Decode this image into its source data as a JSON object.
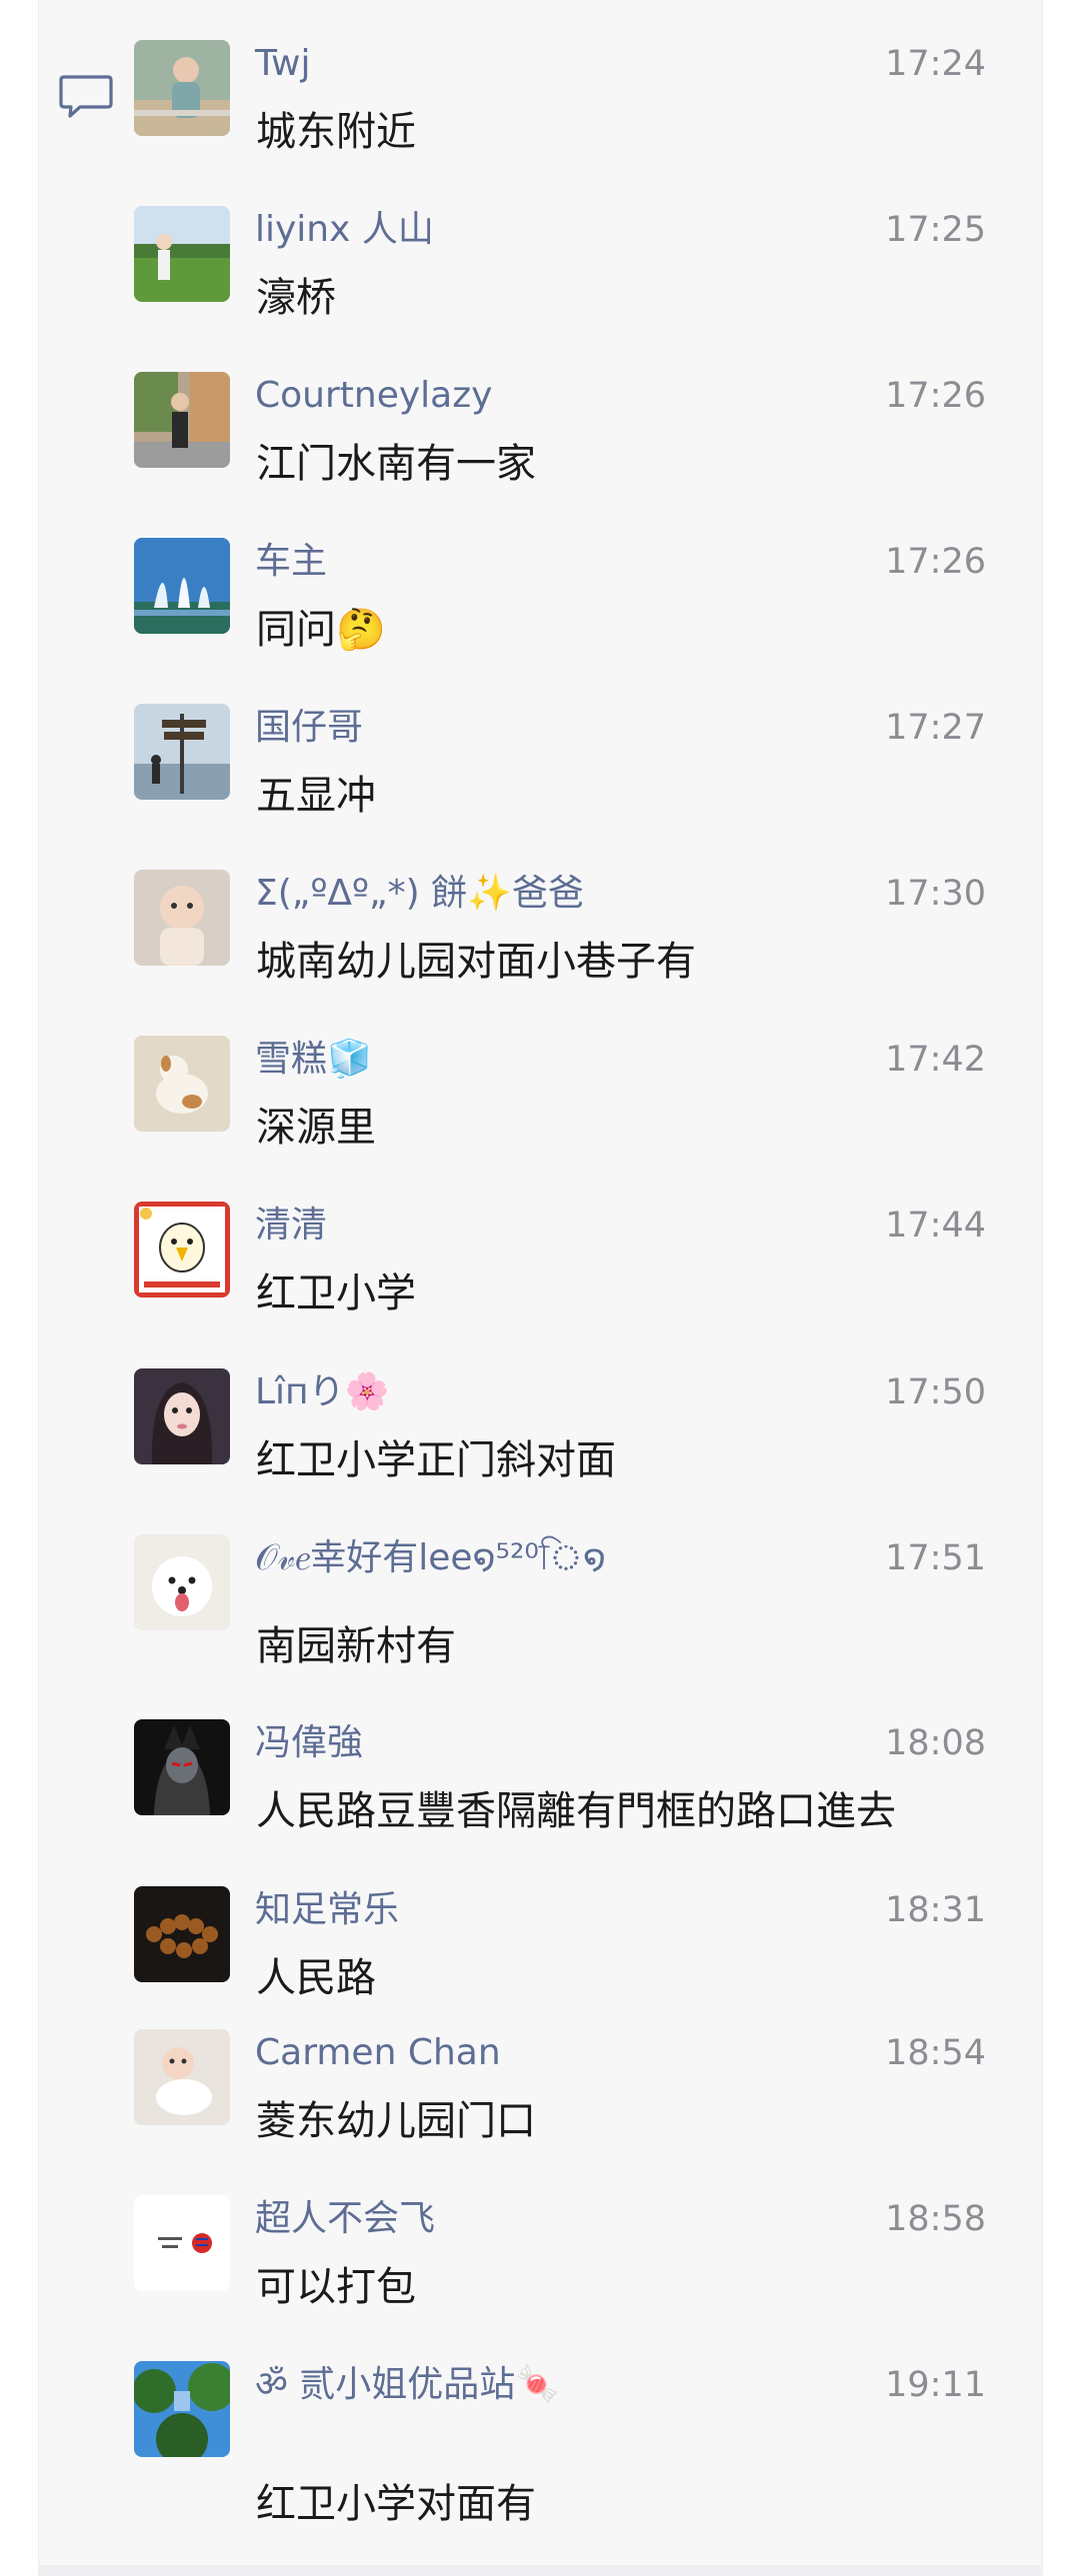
{
  "messages": [
    {
      "name": "Twj",
      "time": "17:24",
      "text": "城东附近"
    },
    {
      "name": "liyinx 人山",
      "time": "17:25",
      "text": "濠桥"
    },
    {
      "name": " Courtneylazy",
      "time": "17:26",
      "text": "江门水南有一家"
    },
    {
      "name": "车主",
      "time": "17:26",
      "text": "同问🤔"
    },
    {
      "name": "国仔哥",
      "time": "17:27",
      "text": "五显冲"
    },
    {
      "name": "Σ(„ºΔº„*)  餅✨爸爸",
      "time": "17:30",
      "text": "城南幼儿园对面小巷子有"
    },
    {
      "name": "雪糕🧊",
      "time": "17:42",
      "text": "深源里"
    },
    {
      "name": "清清",
      "time": "17:44",
      "text": "红卫小学"
    },
    {
      "name": "Lîпり🌸",
      "time": "17:50",
      "text": "红卫小学正门斜对面"
    },
    {
      "name": "𝒪𝓋𝑒幸好有lee໑⁵²⁰ি໑",
      "time": "17:51",
      "text": "南园新村有"
    },
    {
      "name": "冯偉強",
      "time": "18:08",
      "text": "人民路豆豐香隔離有門框的路口進去"
    },
    {
      "name": "知足常乐",
      "time": "18:31",
      "text": "人民路"
    },
    {
      "name": "Carmen  Chan",
      "time": "18:54",
      "text": "菱东幼儿园门口"
    },
    {
      "name": "超人不会飞",
      "time": "18:58",
      "text": "可以打包"
    },
    {
      "name": "ॐ 贰小姐优品站🍬",
      "time": "19:11",
      "text": "红卫小学对面有"
    }
  ],
  "icons": {
    "comment": "comment-icon"
  },
  "colors": {
    "name": "#5d6d93",
    "time": "#8c8c93",
    "text": "#1a1a1a",
    "panel": "#f7f7f8"
  }
}
